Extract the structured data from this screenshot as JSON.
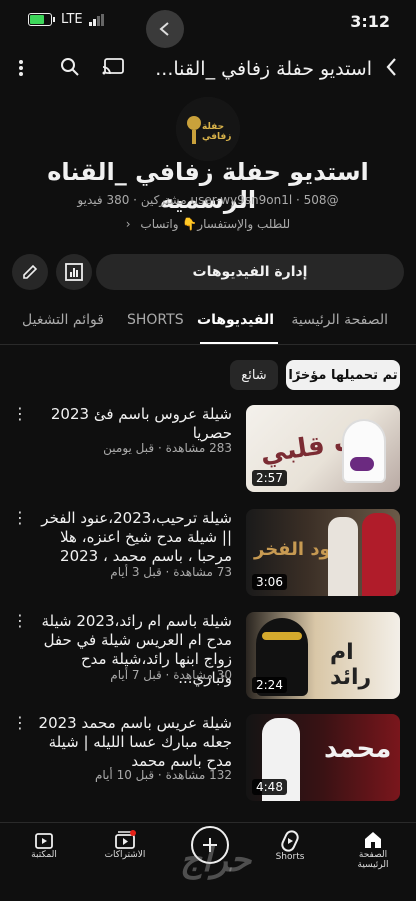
{
  "status_bar": {
    "time": "3:12",
    "network": "LTE"
  },
  "header": {
    "title": "استديو حفلة زفافي _القنا...",
    "icons": [
      "back-arrow-icon",
      "cast-icon",
      "search-icon",
      "more-vert-icon"
    ]
  },
  "channel": {
    "avatar_text": "حفلة زفافي",
    "name": "استديو حفلة زفافي _القناه الرسميه",
    "handle": "@user-wy9sn9on1l",
    "subscribers": "508 مشتركين",
    "videos_count": "380 فيديو",
    "links": "للطلب والإستفسار👇 واتساب"
  },
  "actions": {
    "manage": "إدارة الفيديوهات"
  },
  "tabs": [
    "الصفحة الرئيسية",
    "الفيديوهات",
    "SHORTS",
    "قوائم التشغيل"
  ],
  "chips": [
    "تم تحميلها مؤخرًا",
    "شائع"
  ],
  "videos": [
    {
      "title": "شيلة عروس باسم فئ 2023 حصريا",
      "meta": "283 مشاهدة · قبل يومين",
      "duration": "2:57",
      "thumb_text": "بنت قلبي"
    },
    {
      "title": "شيلة ترحيب،2023،عنود الفخر || شيلة مدح شيخ اعنزه، هلا مرحبا ، باسم محمد ، 2023",
      "meta": "73 مشاهدة · قبل 3 أيام",
      "duration": "3:06",
      "thumb_text": "عنود الفخر"
    },
    {
      "title": "شيلة باسم ام رائد،2023 شيلة مدح ام العريس شيلة في حفل زواج ابنها رائد،شيلة مدح وتباري...",
      "meta": "30 مشاهدة · قبل 7 أيام",
      "duration": "2:24",
      "thumb_text": "ام رائد"
    },
    {
      "title": "شيلة عريس باسم محمد 2023 جعله مبارك عسا الليله | شيلة مدح باسم محمد",
      "meta": "132 مشاهدة · قبل 10 أيام",
      "duration": "4:48",
      "thumb_text": "محمد"
    }
  ],
  "bottom_nav": [
    "الصفحة الرئيسية",
    "Shorts",
    "الاشتراكات",
    "المكتبة"
  ],
  "watermark": "حراج",
  "colors": {
    "background": "#0f0f0f",
    "surface": "#272727",
    "battery": "#3dd65a",
    "accent": "#e62117"
  }
}
